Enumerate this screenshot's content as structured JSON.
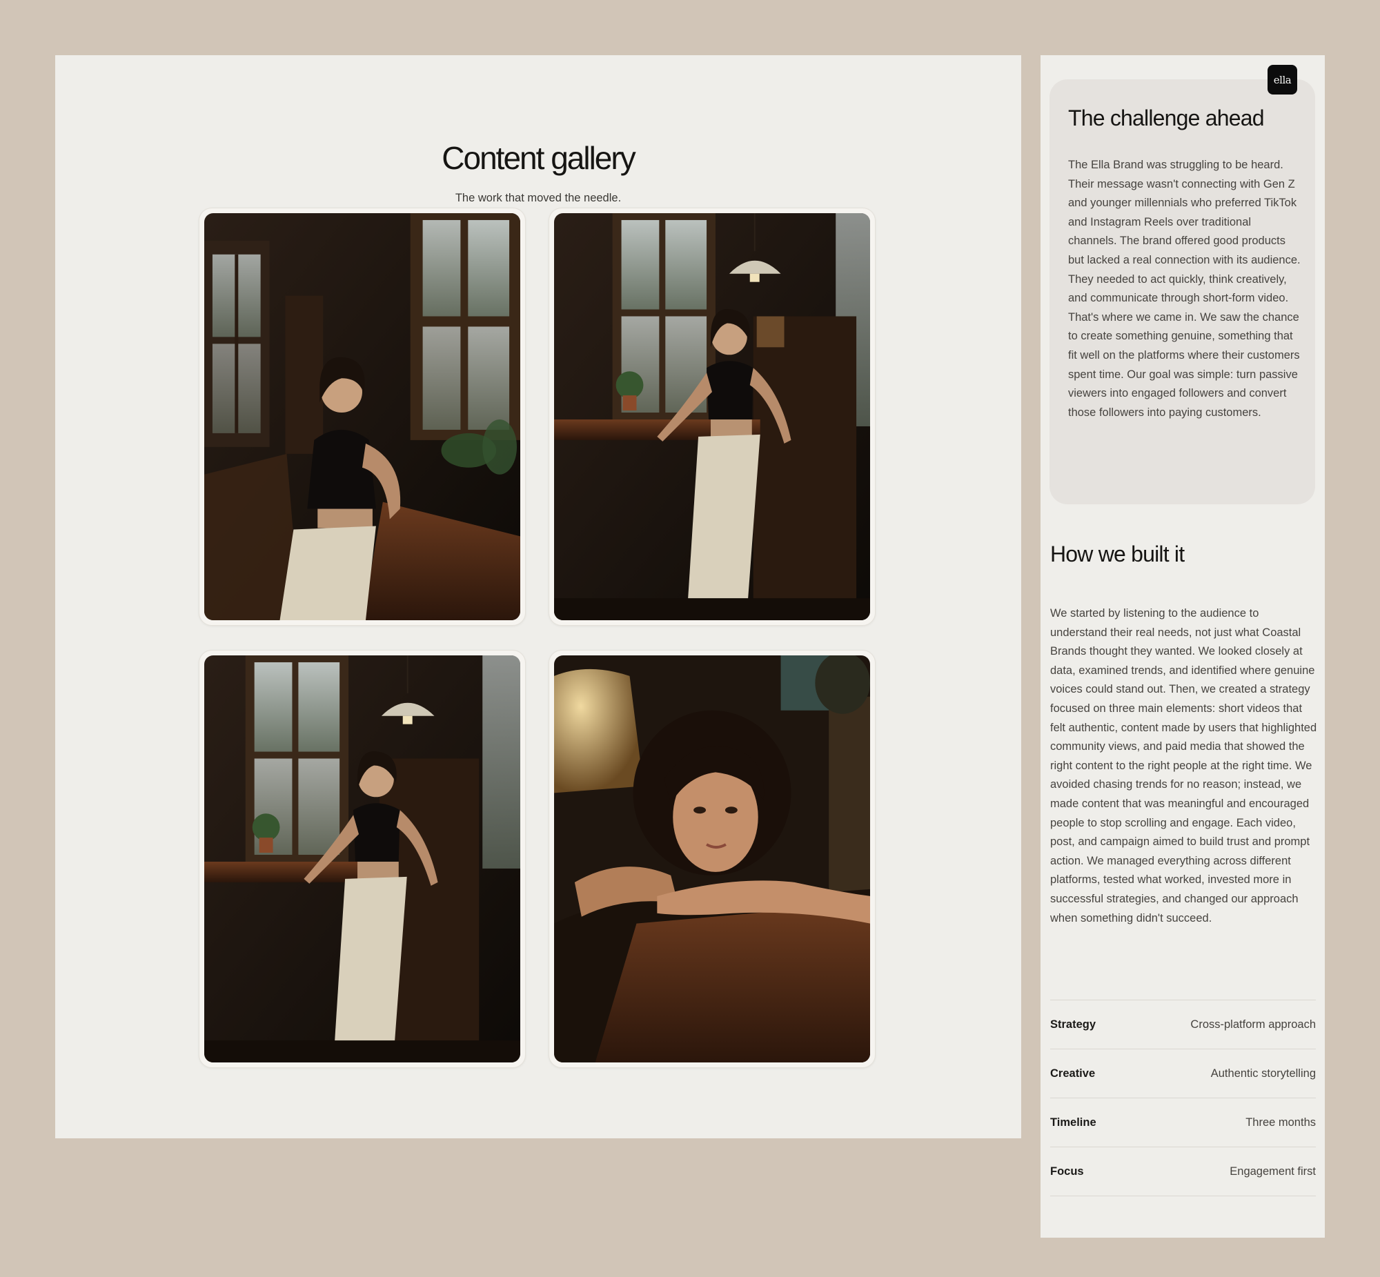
{
  "gallery": {
    "title": "Content gallery",
    "subtitle": "The work that moved the needle.",
    "photos": [
      {
        "name": "woman-leaning-on-desk-by-window"
      },
      {
        "name": "woman-leaning-on-cabinet-under-lamp"
      },
      {
        "name": "woman-leaning-on-cabinet-under-lamp-variant"
      },
      {
        "name": "curly-haired-woman-resting-on-table"
      }
    ]
  },
  "sidebar": {
    "logo_text": "ella",
    "challenge": {
      "title": "The challenge ahead",
      "body": "The Ella Brand was struggling to be heard. Their message wasn't connecting with Gen Z and younger millennials who preferred TikTok and Instagram Reels over traditional channels. The brand offered good products but lacked a real connection with its audience. They needed to act quickly, think creatively, and communicate through short-form video. That's where we came in. We saw the chance to create something genuine, something that fit well on the platforms where their customers spent time. Our goal was simple: turn passive viewers into engaged followers and convert those followers into paying customers."
    },
    "built": {
      "title": "How we built it",
      "body": "We started by listening to the audience to understand their real needs, not just what Coastal Brands thought they wanted. We looked closely at data, examined trends, and identified where genuine voices could stand out. Then, we created a strategy focused on three main elements: short videos that felt authentic, content made by users that highlighted community views, and paid media that showed the right content to the right people at the right time. We avoided chasing trends for no reason; instead, we made content that was meaningful and encouraged people to stop scrolling and engage. Each video, post, and campaign aimed to build trust and prompt action. We managed everything across different platforms, tested what worked, invested more in successful strategies, and changed our approach when something didn't succeed."
    },
    "details": [
      {
        "label": "Strategy",
        "value": "Cross-platform approach"
      },
      {
        "label": "Creative",
        "value": "Authentic storytelling"
      },
      {
        "label": "Timeline",
        "value": "Three months"
      },
      {
        "label": "Focus",
        "value": "Engagement first"
      }
    ]
  },
  "colors": {
    "page_background": "#d1c5b7",
    "panel_background": "#efeeea",
    "card_background": "#e5e2de",
    "logo_background": "#0c0c0c"
  }
}
